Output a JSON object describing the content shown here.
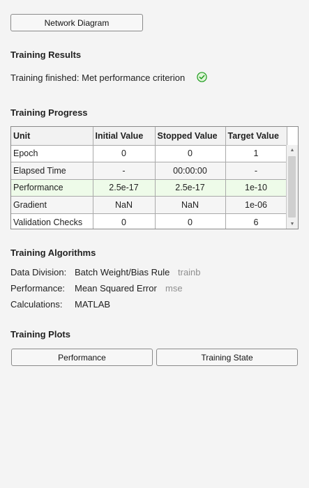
{
  "network_button": "Network Diagram",
  "results": {
    "heading": "Training Results",
    "status": "Training finished: Met performance criterion"
  },
  "progress": {
    "heading": "Training Progress",
    "columns": [
      "Unit",
      "Initial Value",
      "Stopped Value",
      "Target Value"
    ],
    "rows": [
      [
        "Epoch",
        "0",
        "0",
        "1"
      ],
      [
        "Elapsed Time",
        "-",
        "00:00:00",
        "-"
      ],
      [
        "Performance",
        "2.5e-17",
        "2.5e-17",
        "1e-10"
      ],
      [
        "Gradient",
        "NaN",
        "NaN",
        "1e-06"
      ],
      [
        "Validation Checks",
        "0",
        "0",
        "6"
      ]
    ]
  },
  "algorithms": {
    "heading": "Training Algorithms",
    "items": [
      {
        "label": "Data Division:",
        "value": "Batch Weight/Bias Rule",
        "code": "trainb"
      },
      {
        "label": "Performance:",
        "value": "Mean Squared Error",
        "code": "mse"
      },
      {
        "label": "Calculations:",
        "value": "MATLAB",
        "code": ""
      }
    ]
  },
  "plots": {
    "heading": "Training Plots",
    "performance_button": "Performance",
    "training_state_button": "Training State"
  },
  "colors": {
    "check": "#1e9c1e",
    "highlight_row": "#eefbe9"
  }
}
